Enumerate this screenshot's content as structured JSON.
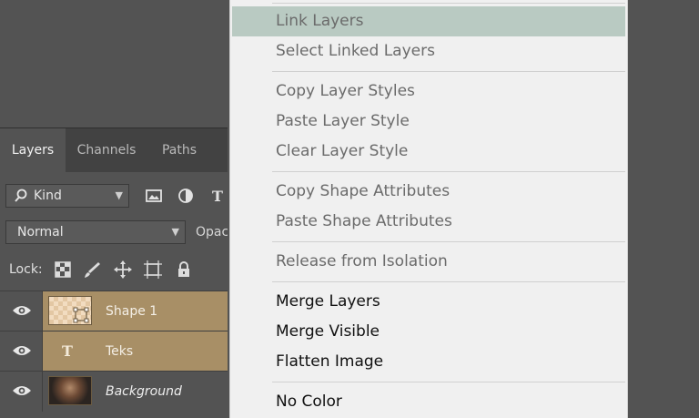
{
  "layers_panel": {
    "tabs": [
      "Layers",
      "Channels",
      "Paths"
    ],
    "active_tab": "Layers",
    "filter": {
      "icon": "search-icon",
      "kind_label": "Kind"
    },
    "filter_icons": [
      "image-filter-icon",
      "adjustment-filter-icon",
      "type-filter-icon"
    ],
    "type_filter_glyph": "T",
    "blend_mode": "Normal",
    "opacity_label": "Opacity:",
    "lock_label": "Lock:",
    "lock_icons": [
      "lock-transparent-pixels-icon",
      "lock-image-pixels-icon",
      "lock-position-icon",
      "lock-artboard-icon",
      "lock-all-icon"
    ],
    "layers": [
      {
        "name": "Shape 1",
        "selected": true,
        "thumb": "shape"
      },
      {
        "name": "Teks",
        "selected": true,
        "thumb": "type",
        "glyph": "T"
      },
      {
        "name": "Background",
        "selected": false,
        "thumb": "photo"
      }
    ],
    "selection_color": "#a88f66"
  },
  "context_menu": {
    "highlight_color": "#b9cac2",
    "items": [
      {
        "label": "Link Layers",
        "enabled": false,
        "highlighted": true
      },
      {
        "label": "Select Linked Layers",
        "enabled": false
      },
      {
        "label": "Copy Layer Styles",
        "enabled": false
      },
      {
        "label": "Paste Layer Style",
        "enabled": false
      },
      {
        "label": "Clear Layer Style",
        "enabled": false
      },
      {
        "label": "Copy Shape Attributes",
        "enabled": false
      },
      {
        "label": "Paste Shape Attributes",
        "enabled": false
      },
      {
        "label": "Release from Isolation",
        "enabled": false
      },
      {
        "label": "Merge Layers",
        "enabled": true
      },
      {
        "label": "Merge Visible",
        "enabled": true
      },
      {
        "label": "Flatten Image",
        "enabled": true
      },
      {
        "label": "No Color",
        "enabled": true
      }
    ]
  }
}
